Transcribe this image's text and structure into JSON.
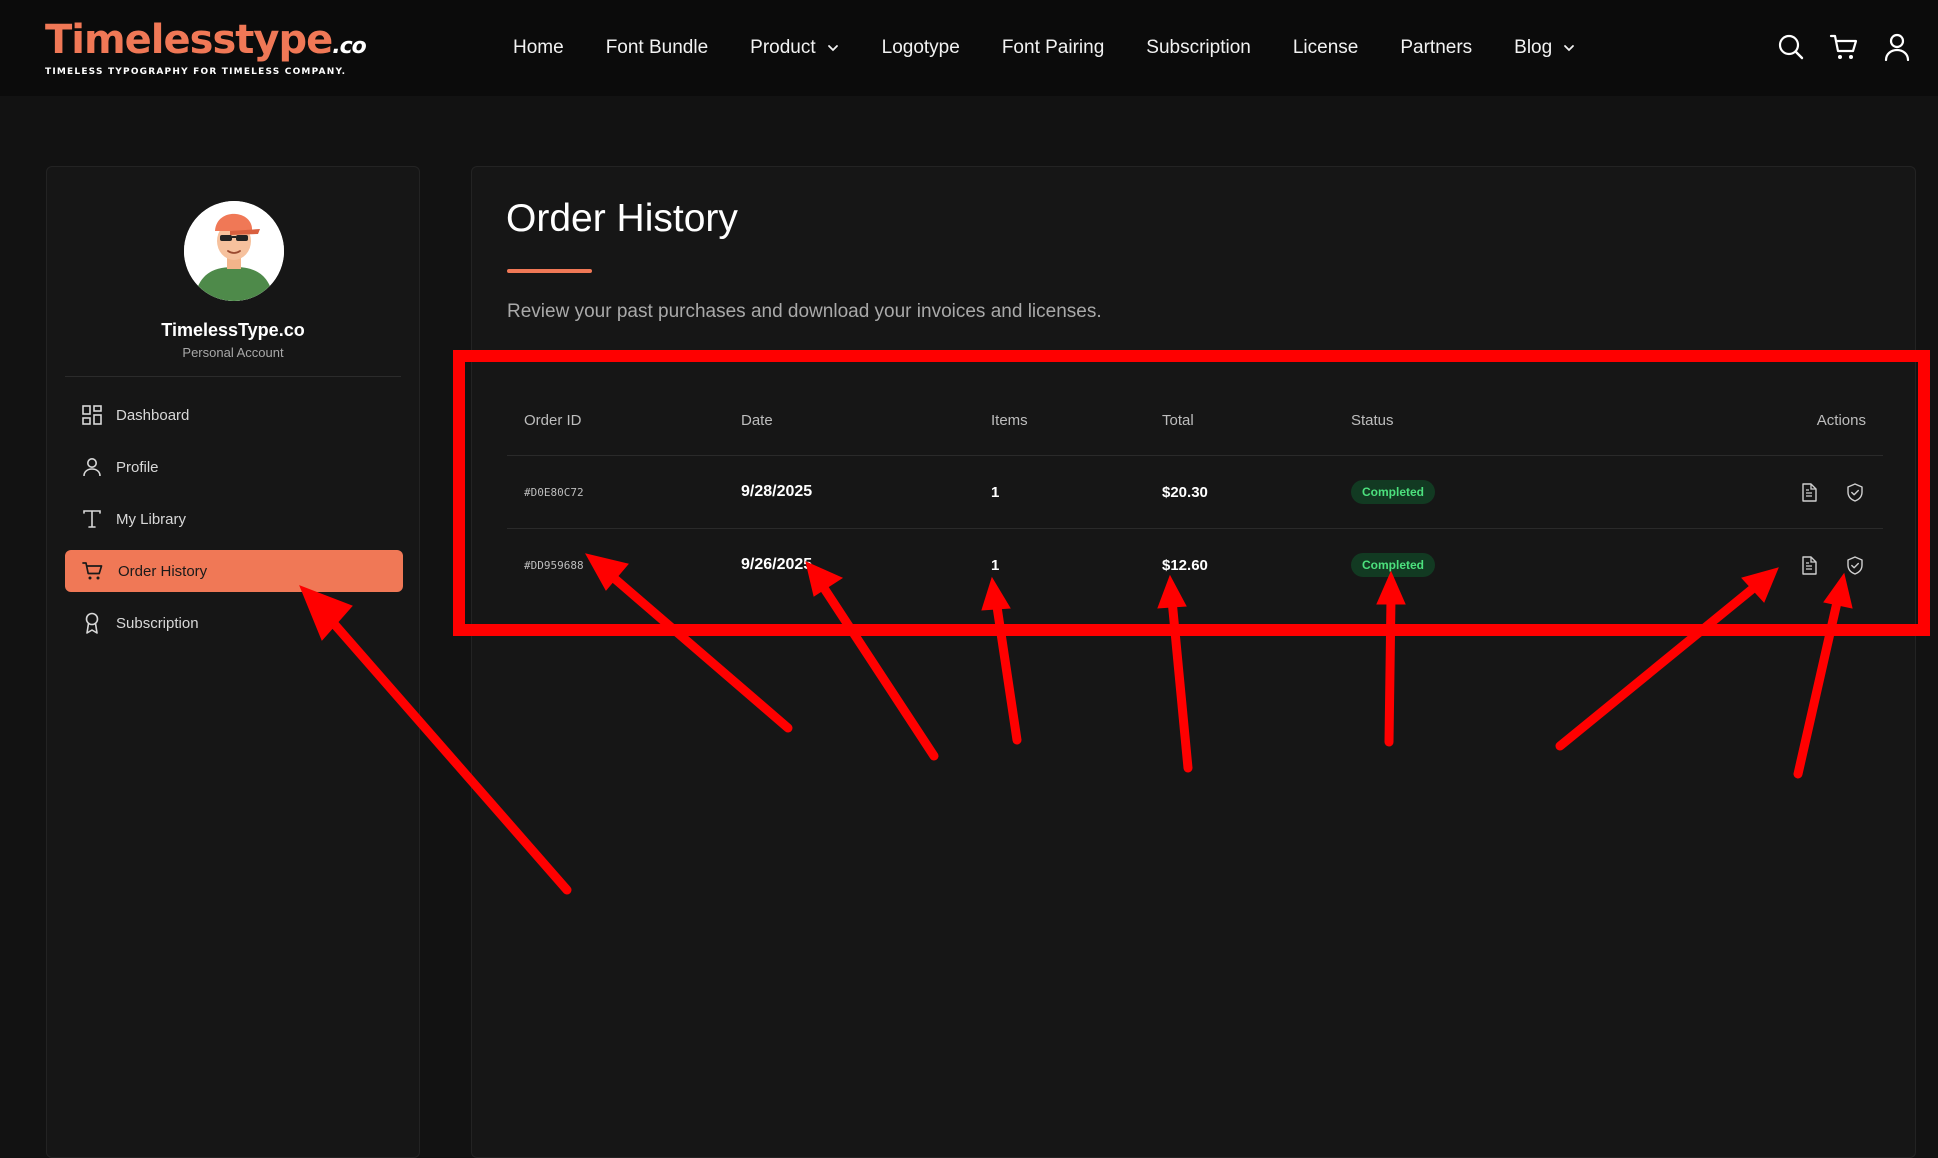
{
  "brand": {
    "logo_text": "Timelesstype",
    "logo_suffix": ".co",
    "tagline": "TIMELESS TYPOGRAPHY FOR TIMELESS COMPANY."
  },
  "nav": {
    "items": [
      {
        "label": "Home"
      },
      {
        "label": "Font Bundle"
      },
      {
        "label": "Product",
        "dropdown": true
      },
      {
        "label": "Logotype"
      },
      {
        "label": "Font Pairing"
      },
      {
        "label": "Subscription"
      },
      {
        "label": "License"
      },
      {
        "label": "Partners"
      },
      {
        "label": "Blog",
        "dropdown": true
      }
    ],
    "icons": [
      "search-icon",
      "cart-icon",
      "user-icon"
    ]
  },
  "profile": {
    "name": "TimelessType.co",
    "account_type": "Personal Account"
  },
  "sidebar": {
    "items": [
      {
        "label": "Dashboard",
        "icon": "dashboard-icon"
      },
      {
        "label": "Profile",
        "icon": "user-icon"
      },
      {
        "label": "My Library",
        "icon": "type-icon"
      },
      {
        "label": "Order History",
        "icon": "cart-icon",
        "active": true
      },
      {
        "label": "Subscription",
        "icon": "award-icon"
      }
    ]
  },
  "page": {
    "title": "Order History",
    "subtitle": "Review your past purchases and download your invoices and licenses."
  },
  "table": {
    "headers": {
      "order_id": "Order ID",
      "date": "Date",
      "items": "Items",
      "total": "Total",
      "status": "Status",
      "actions": "Actions"
    },
    "rows": [
      {
        "order_id": "#D0E80C72",
        "date": "9/28/2025",
        "items": "1",
        "total": "$20.30",
        "status": "Completed"
      },
      {
        "order_id": "#DD959688",
        "date": "9/26/2025",
        "items": "1",
        "total": "$12.60",
        "status": "Completed"
      }
    ]
  },
  "colors": {
    "accent": "#f07856",
    "background": "#121212",
    "panel": "#161616",
    "status_completed_bg": "#123a22",
    "status_completed_text": "#4ce07d",
    "annotation": "#ff0000"
  }
}
